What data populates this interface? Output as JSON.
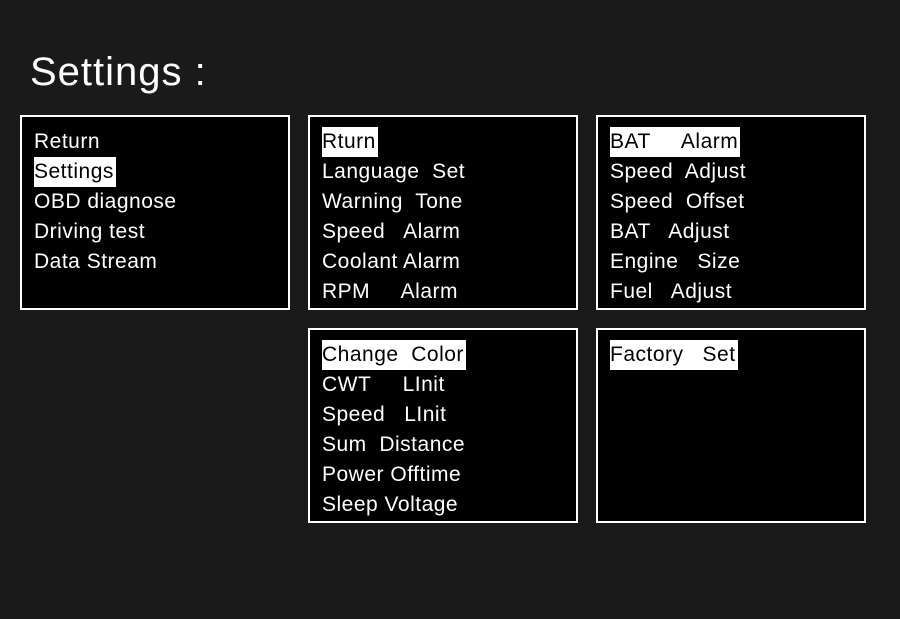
{
  "title": "Settings :",
  "panels": {
    "main": {
      "items": [
        {
          "label": "Return",
          "selected": false
        },
        {
          "label": "Settings",
          "selected": true
        },
        {
          "label": "OBD diagnose",
          "selected": false
        },
        {
          "label": "Driving test",
          "selected": false
        },
        {
          "label": "Data Stream",
          "selected": false
        }
      ]
    },
    "settings1": {
      "items": [
        {
          "label": "Rturn",
          "selected": true
        },
        {
          "label": "Language  Set",
          "selected": false
        },
        {
          "label": "Warning  Tone",
          "selected": false
        },
        {
          "label": "Speed   Alarm",
          "selected": false
        },
        {
          "label": "Coolant Alarm",
          "selected": false
        },
        {
          "label": "RPM     Alarm",
          "selected": false
        }
      ]
    },
    "settings2": {
      "items": [
        {
          "label": "BAT     Alarm",
          "selected": true
        },
        {
          "label": "Speed  Adjust",
          "selected": false
        },
        {
          "label": "Speed  Offset",
          "selected": false
        },
        {
          "label": "BAT   Adjust",
          "selected": false
        },
        {
          "label": "Engine   Size",
          "selected": false
        },
        {
          "label": "Fuel   Adjust",
          "selected": false
        }
      ]
    },
    "settings3": {
      "items": [
        {
          "label": "Change  Color",
          "selected": true
        },
        {
          "label": "CWT     LInit",
          "selected": false
        },
        {
          "label": "Speed   LInit",
          "selected": false
        },
        {
          "label": "Sum  Distance",
          "selected": false
        },
        {
          "label": "Power Offtime",
          "selected": false
        },
        {
          "label": "Sleep Voltage",
          "selected": false
        }
      ]
    },
    "settings4": {
      "items": [
        {
          "label": "Factory   Set",
          "selected": true
        }
      ]
    }
  }
}
